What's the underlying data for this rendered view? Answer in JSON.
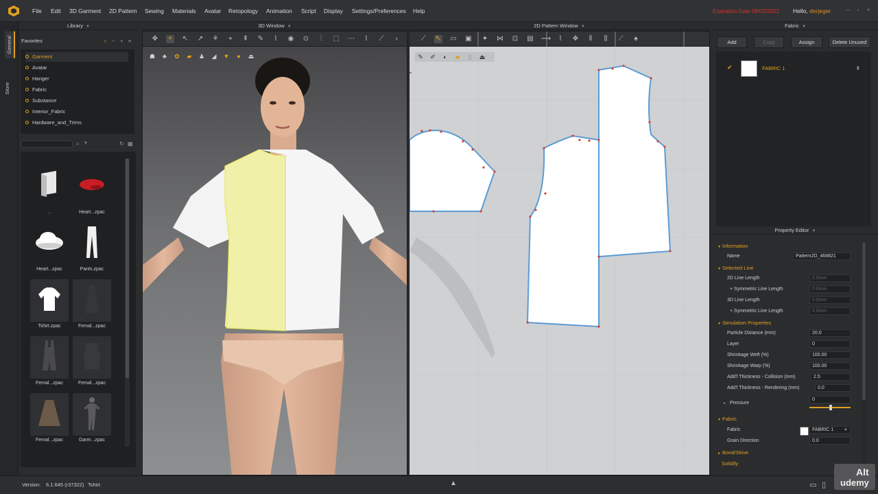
{
  "menubar": {
    "items": [
      "File",
      "Edit",
      "3D Garment",
      "2D Pattern",
      "Sewing",
      "Materials",
      "Avatar",
      "Retopology",
      "Animation",
      "Script",
      "Display",
      "Settings/Preferences",
      "Help"
    ],
    "expiration": "Expiration Date 08/03/2022",
    "hello_prefix": "Hello,",
    "username": "derjeger"
  },
  "side_tabs": [
    "General",
    "Store"
  ],
  "panels": {
    "library_title": "Library",
    "view3d_title": "3D Window",
    "view2d_title": "2D Pattern Window",
    "fabric_title": "Fabric",
    "property_title": "Property Editor"
  },
  "library": {
    "favorites_title": "Favorites",
    "favorites": [
      "Garment",
      "Avatar",
      "Hanger",
      "Fabric",
      "Substance",
      "Interior_Fabric",
      "Hardware_and_Trims"
    ],
    "selected_favorite": "Garment",
    "items": [
      {
        "label": "..",
        "icon": "folder-up-icon"
      },
      {
        "label": "Heart...zpac",
        "icon": "red-cap-icon"
      },
      {
        "label": "Heart...zpac",
        "icon": "white-hat-icon"
      },
      {
        "label": "Pants.zpac",
        "icon": "pants-icon"
      },
      {
        "label": "Tshirt.zpac",
        "icon": "tshirt-icon"
      },
      {
        "label": "Femal...zpac",
        "icon": "dress-icon"
      },
      {
        "label": "Femal...zpac",
        "icon": "overall-icon"
      },
      {
        "label": "Femal...zpac",
        "icon": "jacket-icon"
      },
      {
        "label": "Femal...zpac",
        "icon": "skirt-icon"
      },
      {
        "label": "Garm...zpac",
        "icon": "garment-on-avatar-icon"
      }
    ]
  },
  "fabric": {
    "buttons": [
      "Add",
      "Copy",
      "Assign",
      "Delete Unused"
    ],
    "items": [
      {
        "name": "FABRIC 1",
        "color": "#ffffff"
      }
    ]
  },
  "property_editor": {
    "sections": {
      "information": "Information",
      "selected_line": "Selected Line",
      "simulation": "Simulation Properties",
      "fabric": "Fabric",
      "bond_skive": "Bond/Skive",
      "solidify": "Solidify"
    },
    "name_label": "Name",
    "name_value": "Pattern2D_468821",
    "line_2d_label": "2D Line Length",
    "line_2d_value": "0.0mm",
    "sym_line_2d_label": "+ Symmetric Line Length",
    "sym_line_2d_value": "0.0mm",
    "line_3d_label": "3D Line Length",
    "line_3d_value": "0.0mm",
    "sym_line_3d_label": "+ Symmetric Line Length",
    "sym_line_3d_value": "0.0mm",
    "particle_label": "Particle Distance (mm)",
    "particle_value": "20.0",
    "layer_label": "Layer",
    "layer_value": "0",
    "weft_label": "Shrinkage Weft (%)",
    "weft_value": "100.00",
    "warp_label": "Shrinkage Warp (%)",
    "warp_value": "100.00",
    "collision_label": "Add'l Thickness - Collision (mm)",
    "collision_value": "2.5",
    "rendering_label": "Add'l Thickness - Rendering (mm)",
    "rendering_value": "0.0",
    "pressure_label": "Pressure",
    "pressure_value": "0",
    "pressure_fraction": 0.5,
    "fabric_label": "Fabric",
    "fabric_value": "FABRIC 1",
    "grain_label": "Grain Direction",
    "grain_value": "0.0"
  },
  "status": {
    "version_label": "Version:",
    "version": "6.1.645 (r37322)",
    "file": "Tshirt"
  },
  "watermark": {
    "alt": "Alt",
    "brand": "udemy"
  },
  "colors": {
    "accent": "#e0a020",
    "expiration": "#d8322c",
    "selected_pattern": "#f0f0a0",
    "pattern_outline": "#5b9bd5",
    "point": "#d0453a"
  }
}
